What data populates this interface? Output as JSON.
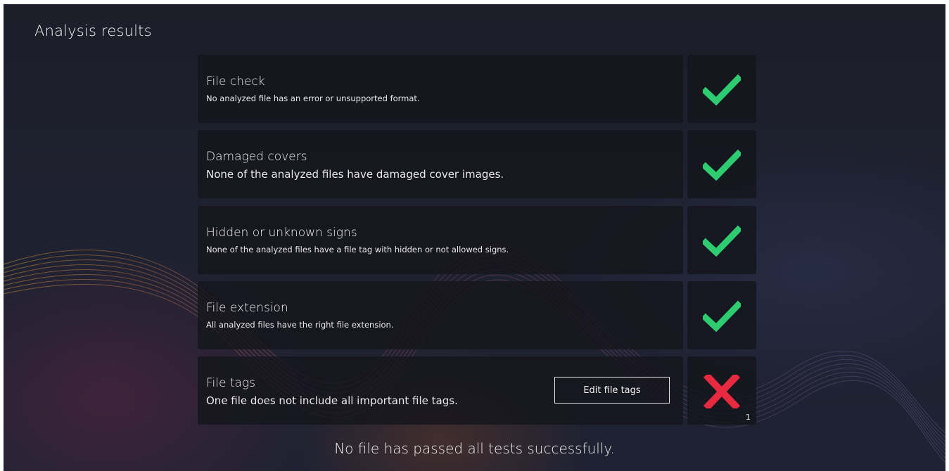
{
  "page": {
    "title": "Analysis results",
    "summary": "No file has passed all tests successfully."
  },
  "results": [
    {
      "title": "File check",
      "description": "No analyzed file has an error or unsupported format.",
      "status": "pass"
    },
    {
      "title": "Damaged covers",
      "description": "None of the analyzed files have damaged cover images.",
      "status": "pass"
    },
    {
      "title": "Hidden or unknown signs",
      "description": "None of the analyzed files have a file tag with hidden or not allowed signs.",
      "status": "pass"
    },
    {
      "title": "File extension",
      "description": "All analyzed files have the right file extension.",
      "status": "pass"
    },
    {
      "title": "File tags",
      "description": "One file does not include all important file tags.",
      "status": "fail",
      "button_label": "Edit file tags",
      "failure_count": "1"
    }
  ],
  "colors": {
    "pass": "#2ecc71",
    "fail": "#e8293f"
  },
  "icons": {
    "pass": "checkmark-icon",
    "fail": "cross-icon"
  }
}
